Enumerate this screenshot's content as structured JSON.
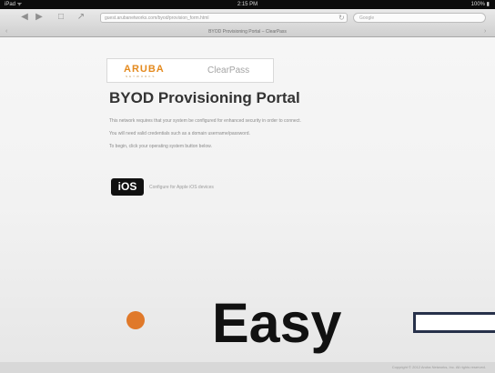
{
  "status_bar": {
    "carrier": "iPad ᯤ",
    "time": "2:15 PM",
    "battery": "100% ▮"
  },
  "browser": {
    "url": "guest.arubanetworks.com/byod/provision_form.html",
    "search_placeholder": "Google",
    "page_title": "BYOD Provisioning Portal – ClearPass"
  },
  "portal": {
    "brand": "ARUBA",
    "brand_sub": "NETWORKS",
    "product": "ClearPass",
    "title": "BYOD Provisioning Portal",
    "lines": [
      "This network requires that your system be configured for enhanced security in order to connect.",
      "You will need valid credentials such as a domain username/password.",
      "To begin, click your operating system button below."
    ],
    "ios_label": "iOS",
    "ios_caption": "Configure for Apple iOS devices"
  },
  "slide": {
    "bullet_color": "#e0792a",
    "headline": "Easy"
  },
  "footer": {
    "text": "Copyright © 2012 Aruba Networks, Inc. All rights reserved."
  }
}
